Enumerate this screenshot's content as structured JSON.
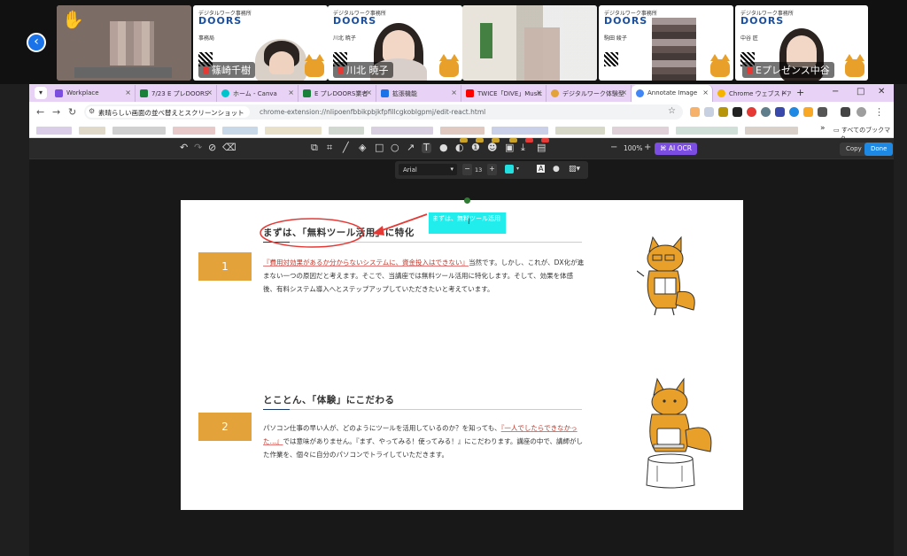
{
  "video_call": {
    "back_icon": "chevron-left-icon",
    "tiles": [
      {
        "name": "",
        "raised_hand": true
      },
      {
        "name": "篠崎千樹",
        "poster_logo": "DOORS",
        "poster_org": "デジタルワーク事務所",
        "poster_role": "事務局"
      },
      {
        "name": "川北 暁子",
        "poster_logo": "DOORS",
        "poster_org": "デジタルワーク事務所",
        "poster_role": "川北 暁子",
        "active": true
      },
      {
        "name": ""
      },
      {
        "name": "",
        "poster_logo": "DOORS",
        "poster_org": "デジタルワーク事務所",
        "poster_role": "駒田 綾子"
      },
      {
        "name": "Eプレゼンス中谷",
        "poster_logo": "DOORS",
        "poster_org": "デジタルワーク事務所",
        "poster_role": "中谷 匠"
      }
    ]
  },
  "browser": {
    "tabs": [
      {
        "label": "Workplace",
        "color": "#7b4de0"
      },
      {
        "label": "7/23 E プレDOORS",
        "color": "#188038"
      },
      {
        "label": "ホーム - Canva",
        "color": "#00c4cc"
      },
      {
        "label": "E プレDOORS業者",
        "color": "#188038"
      },
      {
        "label": "拡張機能",
        "color": "#1a73e8"
      },
      {
        "label": "TWICE「DIVE」Music",
        "color": "#ff0000"
      },
      {
        "label": "デジタルワーク体験型",
        "color": "#e3a23a"
      },
      {
        "label": "Annotate Image",
        "color": "#4285f4",
        "selected": true
      },
      {
        "label": "Chrome ウェブストア",
        "color": "#f4b400"
      }
    ],
    "new_tab": "+",
    "window_controls": [
      "−",
      "□",
      "✕"
    ],
    "page_chip": "素晴らしい画面の並べ替えとスクリーンショット",
    "url": "chrome-extension://nlipoenfbbikpbjkfpfillcgkoblgpmj/edit-react.html",
    "bookmark_folder": "すべてのブックマーク",
    "bookmark_more": "»"
  },
  "editor": {
    "toolbar_icons": [
      "undo-icon",
      "redo-icon",
      "history-icon",
      "eraser-icon",
      "crop-icon",
      "crop-alt-icon",
      "pen-icon",
      "fill-icon",
      "rectangle-icon",
      "circle-icon",
      "arrow-icon",
      "text-icon",
      "drop-icon",
      "blur-icon",
      "info-icon",
      "emoji-icon",
      "stamp-icon",
      "download-icon",
      "screen-icon"
    ],
    "zoom": "100%",
    "zoom_minus": "−",
    "zoom_plus": "+",
    "ai_ocr": "AI OCR",
    "copy": "Copy",
    "done": "Done",
    "text_toolbar": {
      "font": "Arial",
      "size": "13",
      "minus": "−",
      "plus": "+",
      "color": "#22e0e0"
    }
  },
  "slide": {
    "sections": [
      {
        "number": "1",
        "title_a": "まずは、「",
        "title_b": "無料ツール活用",
        "title_c": "」に特化",
        "body_underlined": "『費用対効果があるか分からないシステムに、資金投入はできない』",
        "body": "当然です。しかし、これが、DX化が進まない一つの原因だと考えます。そこで、当講座では無料ツール活用に特化します。そして、効果を体感後、有料システム導入へとステップアップしていただきたいと考えています。"
      },
      {
        "number": "2",
        "title": "とことん、「体験」にこだわる",
        "body_a": "パソコン仕事の早い人が、どのようにツールを活用しているのか？を知っても、",
        "body_underlined": "『一人でしたらできなかった…』",
        "body_b": "では意味がありません。『まず、やってみる！使ってみる！』にこだわります。講座の中で、講師がした作業を、個々に自分のパソコンでトライしていただきます。"
      }
    ],
    "annotation_text": "まずは、無料ツール活用",
    "annotation_color": "#22eded",
    "highlight_color": "#e53935"
  }
}
